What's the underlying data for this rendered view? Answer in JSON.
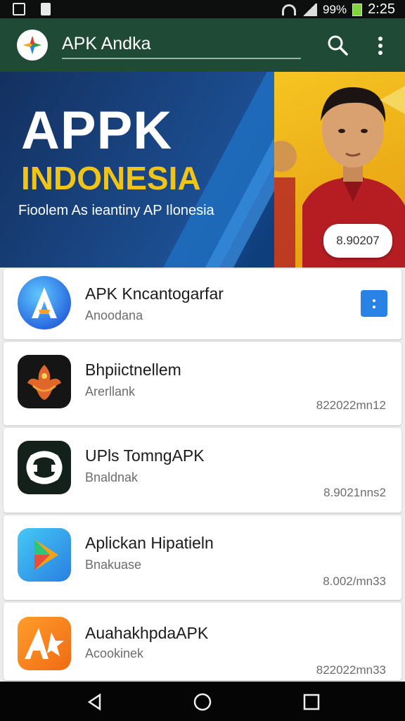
{
  "status_bar": {
    "battery": "99%",
    "time": "2:25"
  },
  "app_bar": {
    "search_value": "APK Andka"
  },
  "banner": {
    "title_line1": "APPK",
    "title_line2": "INDONESIA",
    "subtitle": "Fioolem As ieantiny AP Ilonesia",
    "bubble": "8.90207"
  },
  "apps": [
    {
      "name": "APK Kncantogarfar",
      "developer": "Anoodana",
      "meta": "",
      "icon": "a-letter-icon"
    },
    {
      "name": "Bhpiictnellem",
      "developer": "Arerllank",
      "meta": "822022mn12",
      "icon": "garuda-icon"
    },
    {
      "name": "UPls TomngAPK",
      "developer": "Bnaldnak",
      "meta": "8.9021nns2",
      "icon": "link-icon"
    },
    {
      "name": "Aplickan Hipatieln",
      "developer": "Bnakuase",
      "meta": "8.002/mn33",
      "icon": "play-icon"
    },
    {
      "name": "AuahakhpdaAPK",
      "developer": "Acookinek",
      "meta": "822022mn33",
      "icon": "a-star-icon"
    }
  ],
  "colors": {
    "app_bar": "#1f4a35",
    "accent": "#2a82e6",
    "banner_yellow": "#f0c419"
  }
}
